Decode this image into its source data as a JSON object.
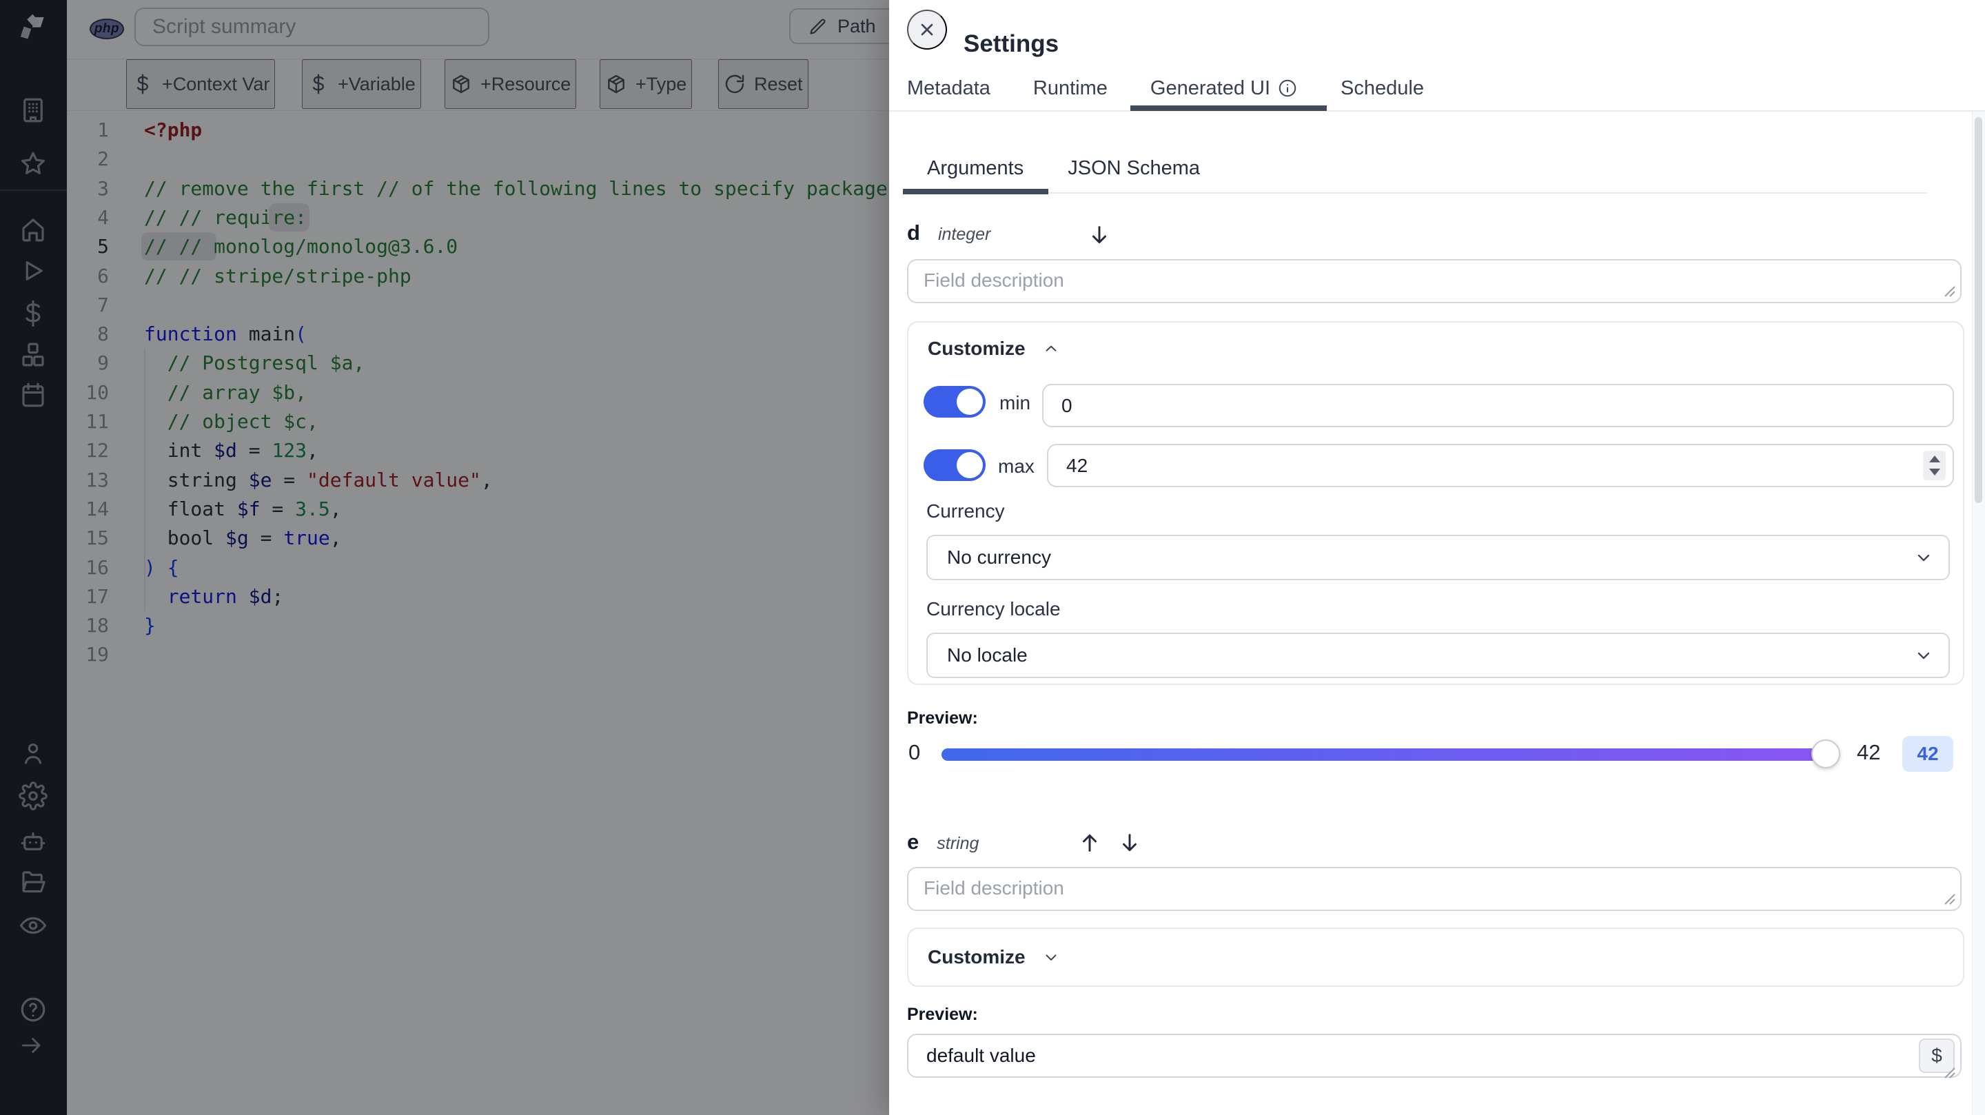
{
  "topbar": {
    "language_badge": "php",
    "summary_placeholder": "Script summary",
    "path_button": "Path"
  },
  "toolbar": {
    "context_var": "+Context Var",
    "variable": "+Variable",
    "resource": "+Resource",
    "type": "+Type",
    "reset": "Reset"
  },
  "editor": {
    "lines": [
      {
        "n": "1",
        "tokens": [
          [
            "tag",
            "<?php",
            0
          ]
        ]
      },
      {
        "n": "2",
        "tokens": []
      },
      {
        "n": "3",
        "tokens": [
          [
            "comment",
            "// remove the first // of the following lines to specify packages:",
            0
          ]
        ]
      },
      {
        "n": "4",
        "tokens": [
          [
            "comment",
            "// // requi",
            0
          ],
          [
            "comment",
            "re:",
            1
          ]
        ]
      },
      {
        "n": "5",
        "active": true,
        "tokens": [
          [
            "comment",
            "// // ",
            1
          ],
          [
            "comment",
            "monolog/monolog@3.6.0",
            0
          ]
        ]
      },
      {
        "n": "6",
        "tokens": [
          [
            "comment",
            "// // stripe/stripe-php",
            0
          ]
        ]
      },
      {
        "n": "7",
        "tokens": []
      },
      {
        "n": "8",
        "tokens": [
          [
            "kw",
            "function",
            0
          ],
          [
            "plain",
            " main",
            0
          ],
          [
            "paren",
            "(",
            0
          ]
        ]
      },
      {
        "n": "9",
        "tokens": [
          [
            "plain",
            "  ",
            0
          ],
          [
            "comment",
            "// Postgresql $a,",
            0
          ]
        ]
      },
      {
        "n": "10",
        "tokens": [
          [
            "plain",
            "  ",
            0
          ],
          [
            "comment",
            "// array $b,",
            0
          ]
        ]
      },
      {
        "n": "11",
        "tokens": [
          [
            "plain",
            "  ",
            0
          ],
          [
            "comment",
            "// object $c,",
            0
          ]
        ]
      },
      {
        "n": "12",
        "tokens": [
          [
            "plain",
            "  int ",
            0
          ],
          [
            "var",
            "$d",
            0
          ],
          [
            "plain",
            " = ",
            0
          ],
          [
            "num",
            "123",
            0
          ],
          [
            "plain",
            ",",
            0
          ]
        ]
      },
      {
        "n": "13",
        "tokens": [
          [
            "plain",
            "  string ",
            0
          ],
          [
            "var",
            "$e",
            0
          ],
          [
            "plain",
            " = ",
            0
          ],
          [
            "str",
            "\"default value\"",
            0
          ],
          [
            "plain",
            ",",
            0
          ]
        ]
      },
      {
        "n": "14",
        "tokens": [
          [
            "plain",
            "  float ",
            0
          ],
          [
            "var",
            "$f",
            0
          ],
          [
            "plain",
            " = ",
            0
          ],
          [
            "num",
            "3.5",
            0
          ],
          [
            "plain",
            ",",
            0
          ]
        ]
      },
      {
        "n": "15",
        "tokens": [
          [
            "plain",
            "  bool ",
            0
          ],
          [
            "var",
            "$g",
            0
          ],
          [
            "plain",
            " = ",
            0
          ],
          [
            "kw",
            "true",
            0
          ],
          [
            "plain",
            ",",
            0
          ]
        ]
      },
      {
        "n": "16",
        "tokens": [
          [
            "paren",
            ") {",
            0
          ]
        ]
      },
      {
        "n": "17",
        "tokens": [
          [
            "plain",
            "  ",
            0
          ],
          [
            "kw",
            "return",
            0
          ],
          [
            "plain",
            " ",
            0
          ],
          [
            "var",
            "$d",
            0
          ],
          [
            "plain",
            ";",
            0
          ]
        ]
      },
      {
        "n": "18",
        "tokens": [
          [
            "paren",
            "}",
            0
          ]
        ]
      },
      {
        "n": "19",
        "tokens": []
      }
    ]
  },
  "settings": {
    "title": "Settings",
    "tabs": {
      "metadata": "Metadata",
      "runtime": "Runtime",
      "generated_ui": "Generated UI",
      "schedule": "Schedule"
    },
    "subtabs": {
      "arguments": "Arguments",
      "json_schema": "JSON Schema"
    },
    "field_d": {
      "name": "d",
      "type": "integer",
      "description_placeholder": "Field description",
      "customize": "Customize",
      "min_label": "min",
      "min_value": "0",
      "max_label": "max",
      "max_value": "42",
      "currency_label": "Currency",
      "currency_value": "No currency",
      "locale_label": "Currency locale",
      "locale_value": "No locale",
      "preview_label": "Preview:",
      "slider_min": "0",
      "slider_max": "42",
      "slider_value": "42"
    },
    "field_e": {
      "name": "e",
      "type": "string",
      "description_placeholder": "Field description",
      "customize": "Customize",
      "preview_label": "Preview:",
      "value": "default value",
      "dollar_button": "$"
    }
  },
  "colors": {
    "accent_blue": "#3b5ee8",
    "slider_gradient_start": "#4169ec",
    "slider_gradient_end": "#8a55f2",
    "badge_bg": "#dce8fd",
    "badge_text": "#3a63e3",
    "status_green": "#57b368",
    "php_badge": "#767bb3"
  }
}
